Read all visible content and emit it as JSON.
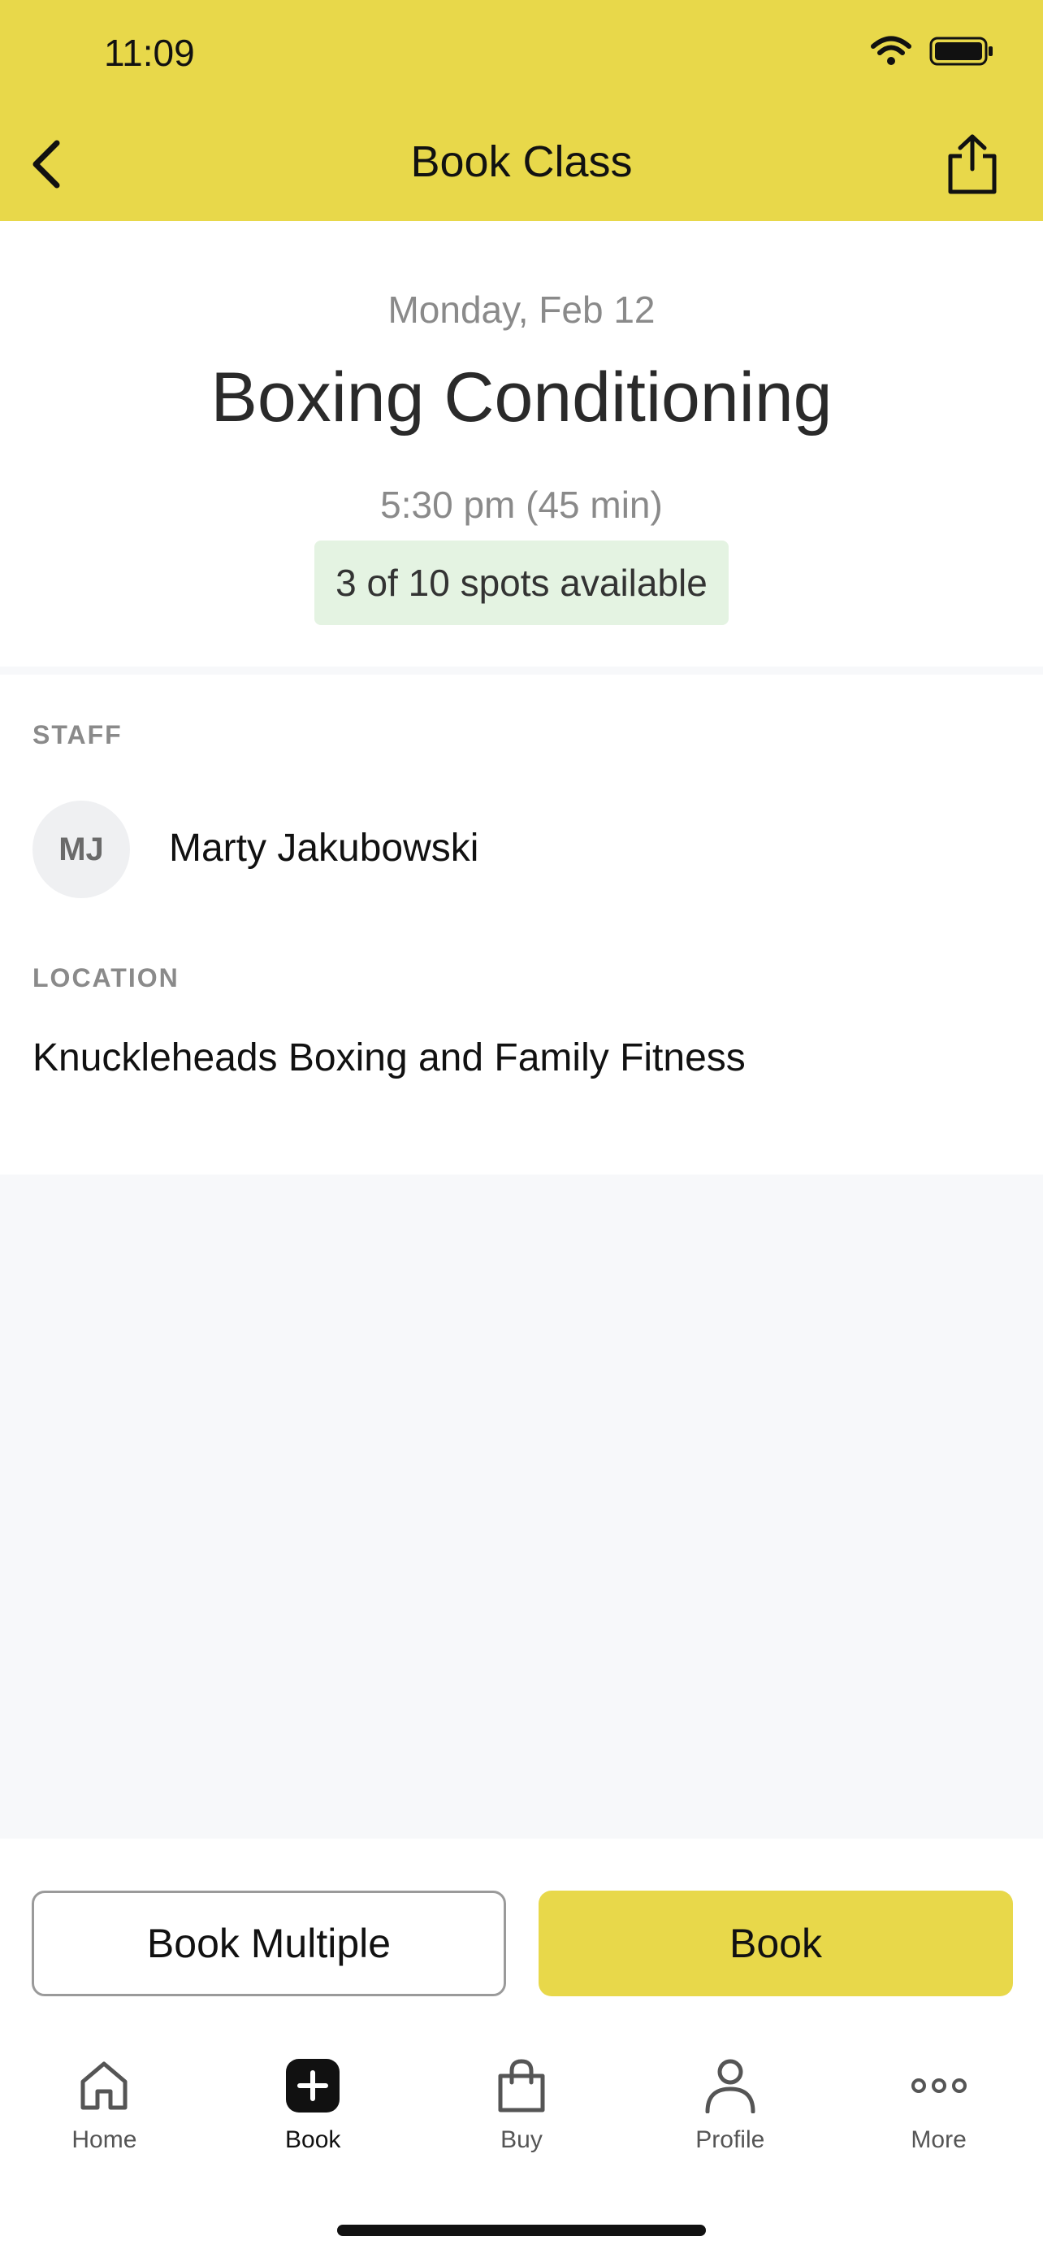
{
  "status_bar": {
    "time": "11:09"
  },
  "nav": {
    "title": "Book Class"
  },
  "class": {
    "date": "Monday, Feb 12",
    "title": "Boxing Conditioning",
    "time": "5:30 pm (45 min)",
    "spots": "3 of 10 spots available"
  },
  "staff": {
    "label": "STAFF",
    "initials": "MJ",
    "name": "Marty Jakubowski"
  },
  "location": {
    "label": "LOCATION",
    "name": "Knuckleheads Boxing and Family Fitness"
  },
  "actions": {
    "book_multiple": "Book Multiple",
    "book": "Book"
  },
  "tabbar": {
    "items": [
      {
        "label": "Home",
        "icon": "home-icon"
      },
      {
        "label": "Book",
        "icon": "plus-square-icon",
        "active": true
      },
      {
        "label": "Buy",
        "icon": "shopping-bag-icon"
      },
      {
        "label": "Profile",
        "icon": "person-icon"
      },
      {
        "label": "More",
        "icon": "more-dots-icon"
      }
    ]
  },
  "colors": {
    "accent": "#e8d84a",
    "badge_bg": "#e4f3e2"
  }
}
